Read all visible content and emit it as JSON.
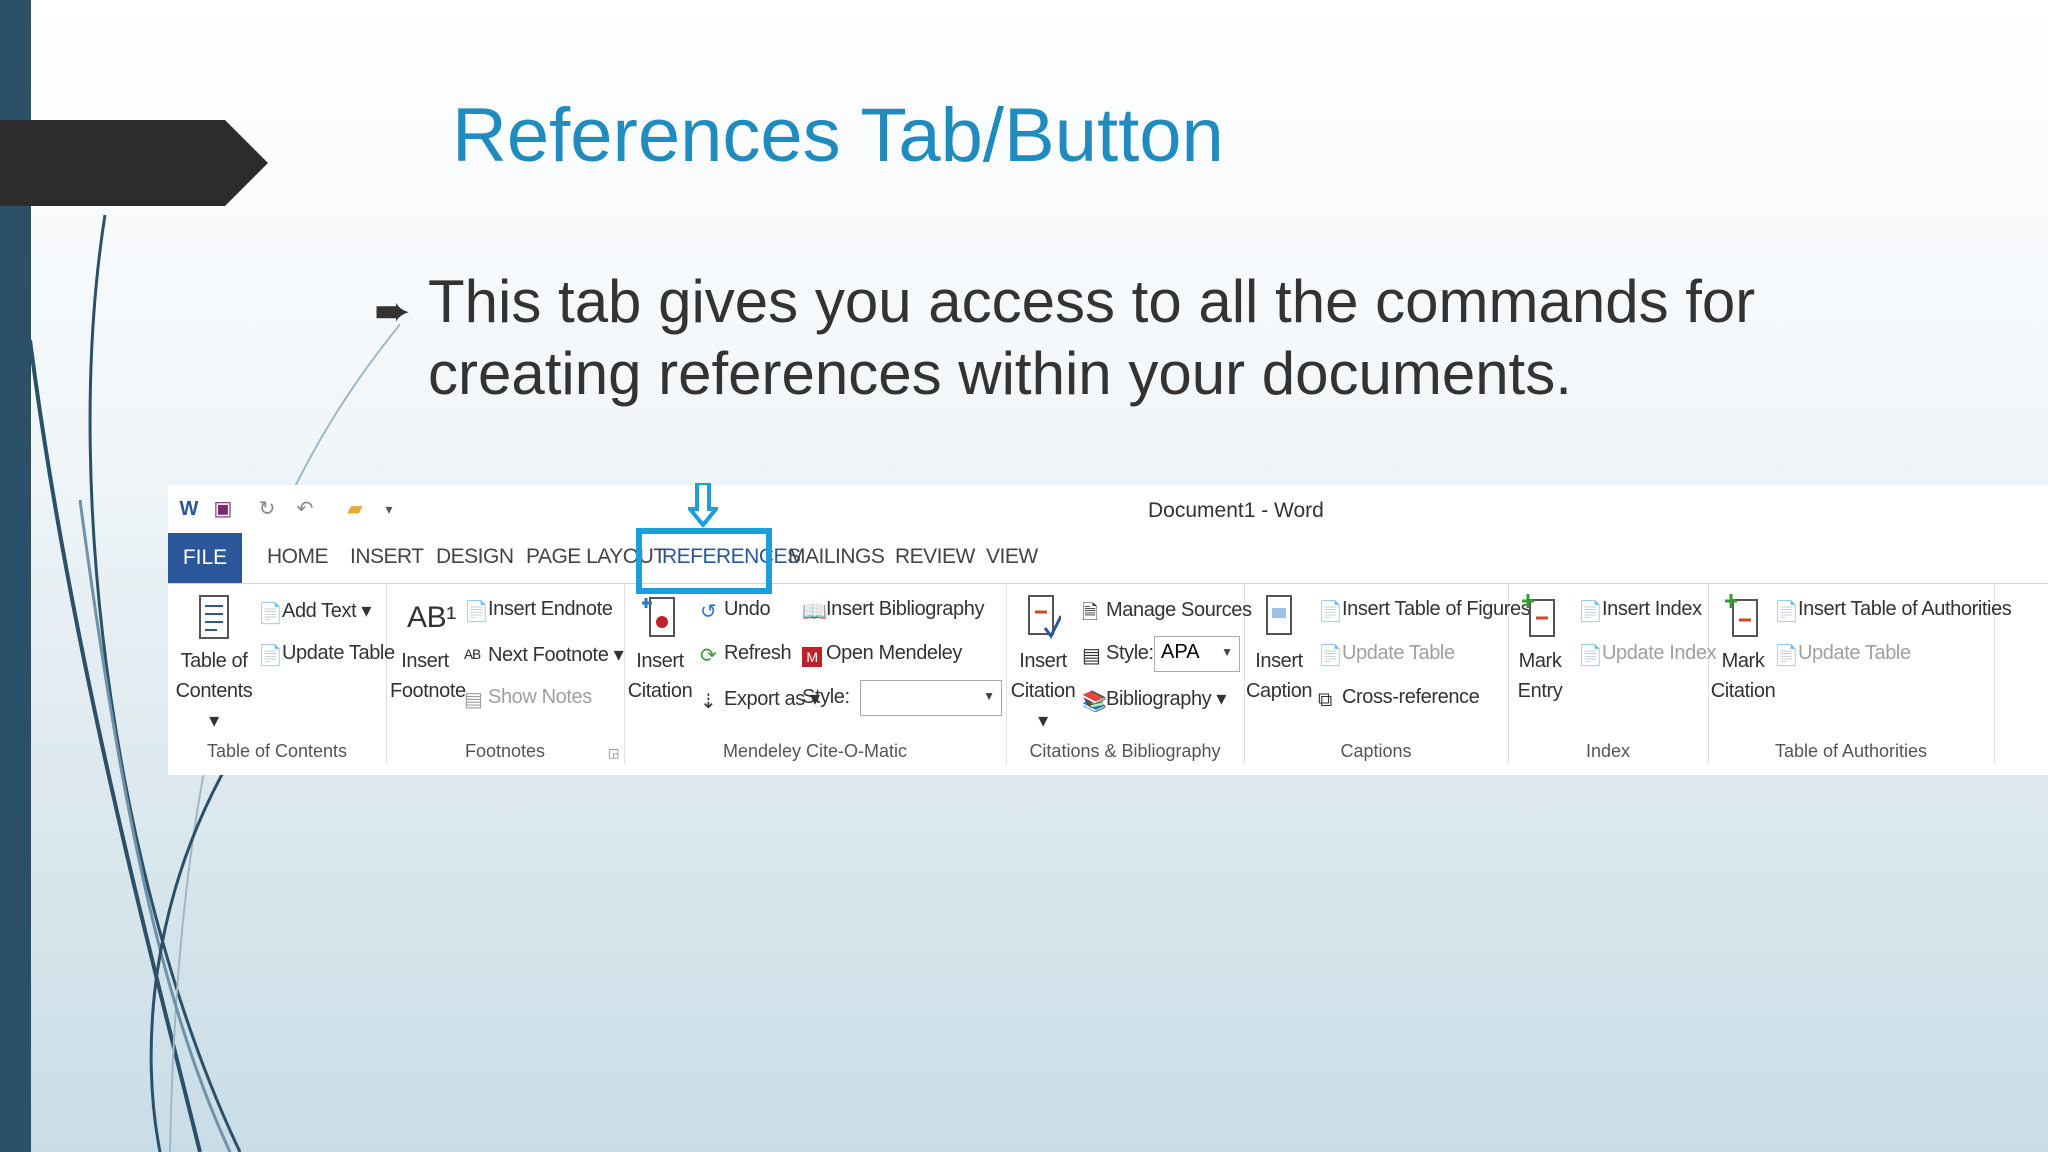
{
  "slide": {
    "title": "References Tab/Button",
    "bullet_glyph": "➨",
    "body": "This tab gives you access to all the commands for creating references within your documents."
  },
  "word": {
    "doc_title": "Document1 - Word",
    "tabs": [
      "FILE",
      "HOME",
      "INSERT",
      "DESIGN",
      "PAGE LAYOUT",
      "REFERENCES",
      "MAILINGS",
      "REVIEW",
      "VIEW"
    ],
    "highlight_color": "#1a9fdb",
    "groups": {
      "toc": {
        "label": "Table of Contents",
        "big": [
          "Table of",
          "Contents ▾"
        ],
        "add_text": "Add Text ▾",
        "update_table": "Update Table"
      },
      "footnotes": {
        "label": "Footnotes",
        "big": [
          "Insert",
          "Footnote"
        ],
        "big_icon": "AB¹",
        "insert_endnote": "Insert Endnote",
        "next_footnote": "Next Footnote",
        "show_notes": "Show Notes"
      },
      "mendeley": {
        "label": "Mendeley Cite-O-Matic",
        "big": [
          "Insert",
          "Citation"
        ],
        "undo": "Undo",
        "refresh": "Refresh",
        "export_as": "Export as ▾",
        "style_label": "Style:",
        "style_value": "",
        "insert_bibliography": "Insert Bibliography",
        "open_mendeley": "Open Mendeley"
      },
      "citations": {
        "label": "Citations & Bibliography",
        "big": [
          "Insert",
          "Citation ▾"
        ],
        "manage_sources": "Manage Sources",
        "style_label": "Style:",
        "style_value": "APA",
        "bibliography": "Bibliography ▾"
      },
      "captions": {
        "label": "Captions",
        "big": [
          "Insert",
          "Caption"
        ],
        "insert_tof": "Insert Table of Figures",
        "update_table": "Update Table",
        "cross_reference": "Cross-reference"
      },
      "index": {
        "label": "Index",
        "big": [
          "Mark",
          "Entry"
        ],
        "insert_index": "Insert Index",
        "update_index": "Update Index"
      },
      "toa": {
        "label": "Table of Authorities",
        "big": [
          "Mark",
          "Citation"
        ],
        "insert_toa": "Insert Table of Authorities",
        "update_table": "Update Table"
      }
    }
  }
}
